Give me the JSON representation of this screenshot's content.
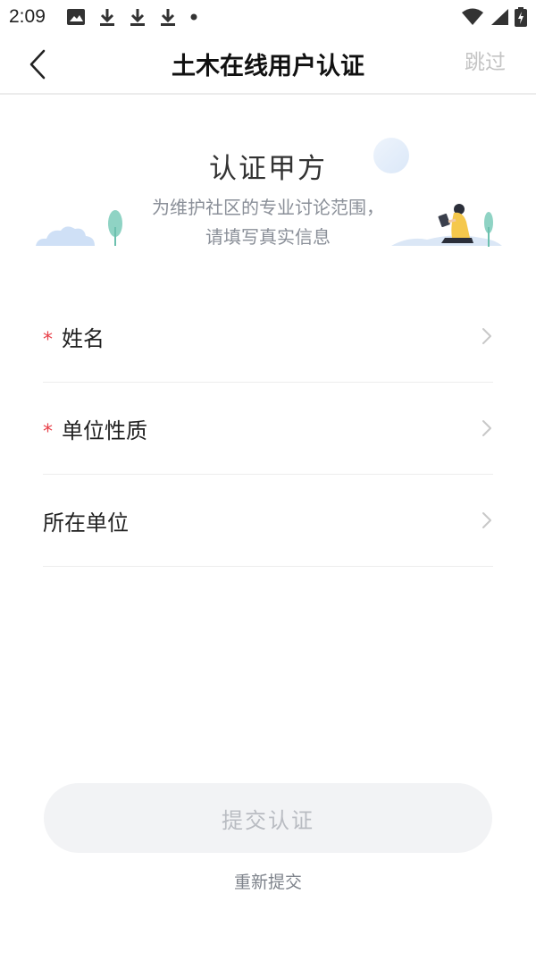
{
  "status_bar": {
    "time": "2:09",
    "icons": [
      "image-icon",
      "download-icon",
      "download-icon",
      "download-icon",
      "dot-icon",
      "wifi-icon",
      "signal-icon",
      "battery-charging-icon"
    ]
  },
  "header": {
    "title": "土木在线用户认证",
    "skip_label": "跳过"
  },
  "banner": {
    "title": "认证甲方",
    "subtitle_line1": "为维护社区的专业讨论范围，",
    "subtitle_line2": "请填写真实信息"
  },
  "form": {
    "required_mark": "*",
    "rows": [
      {
        "label": "姓名",
        "required": true
      },
      {
        "label": "单位性质",
        "required": true
      },
      {
        "label": "所在单位",
        "required": false
      }
    ]
  },
  "submit_label": "提交认证",
  "resubmit_label": "重新提交",
  "colors": {
    "required": "#e8414a",
    "muted_text": "#8a8f98",
    "button_bg": "#f2f3f5",
    "button_text": "#b9bcc2"
  }
}
